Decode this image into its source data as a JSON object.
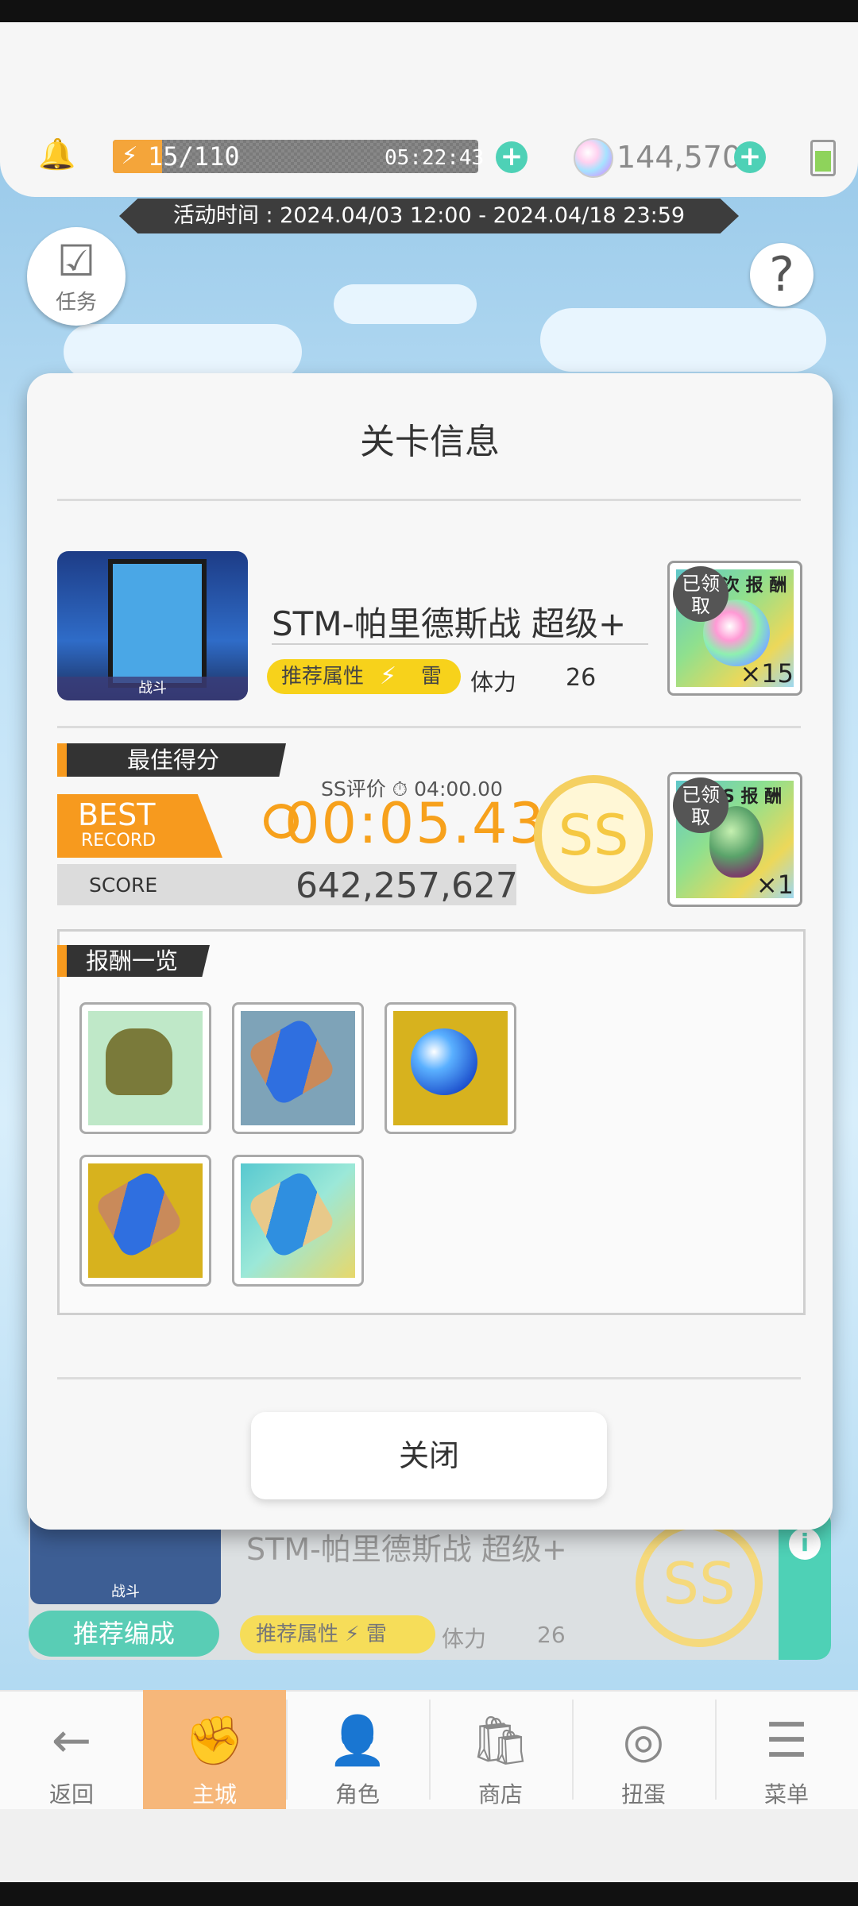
{
  "topbar": {
    "stamina": "15/110",
    "stamina_timer": "05:22:43",
    "gems": "144,570"
  },
  "event": {
    "period": "活动时间 : 2024.04/03 12:00 - 2024.04/18 23:59"
  },
  "side": {
    "task_label": "任务",
    "help_icon": "?"
  },
  "modal": {
    "title": "关卡信息",
    "stage": {
      "thumb_tag": "战斗",
      "name": "STM-帕里德斯战 超级+",
      "recommend_label": "推荐属性",
      "element": "雷",
      "stamina_label": "体力",
      "stamina_cost": "26"
    },
    "first_reward": {
      "claimed": "已领取",
      "head": "次 报 酬",
      "qty": "×15"
    },
    "best": {
      "tag": "最佳得分",
      "badge_line1": "BEST",
      "badge_line2": "RECORD",
      "ss_eval": "SS评价 ⏱ 04:00.00",
      "time": "00:05.43",
      "score_label": "SCORE",
      "score": "642,257,627",
      "rank": "SS"
    },
    "ss_reward": {
      "claimed": "已领取",
      "head": "S 报 酬",
      "qty": "×1"
    },
    "rewards_title": "报酬一览",
    "close_label": "关闭"
  },
  "background_card": {
    "name": "STM-帕里德斯战 超级+",
    "thumb_tag": "战斗",
    "recommend_team": "推荐编成",
    "recommend_label": "推荐属性",
    "element": "雷",
    "stamina_label": "体力",
    "stamina_cost": "26",
    "rank": "SS",
    "info_icon": "i"
  },
  "nav": {
    "items": [
      {
        "label": "返回",
        "icon": "back-arrow-icon"
      },
      {
        "label": "主城",
        "icon": "main-city-icon"
      },
      {
        "label": "角色",
        "icon": "character-icon"
      },
      {
        "label": "商店",
        "icon": "shop-icon"
      },
      {
        "label": "扭蛋",
        "icon": "gacha-icon"
      },
      {
        "label": "菜单",
        "icon": "menu-icon"
      }
    ],
    "active_index": 1
  },
  "colors": {
    "accent_orange": "#f79a1e",
    "teal": "#4ed1b6",
    "gold": "#f5c842",
    "yellow_pill": "#f7d21b"
  }
}
